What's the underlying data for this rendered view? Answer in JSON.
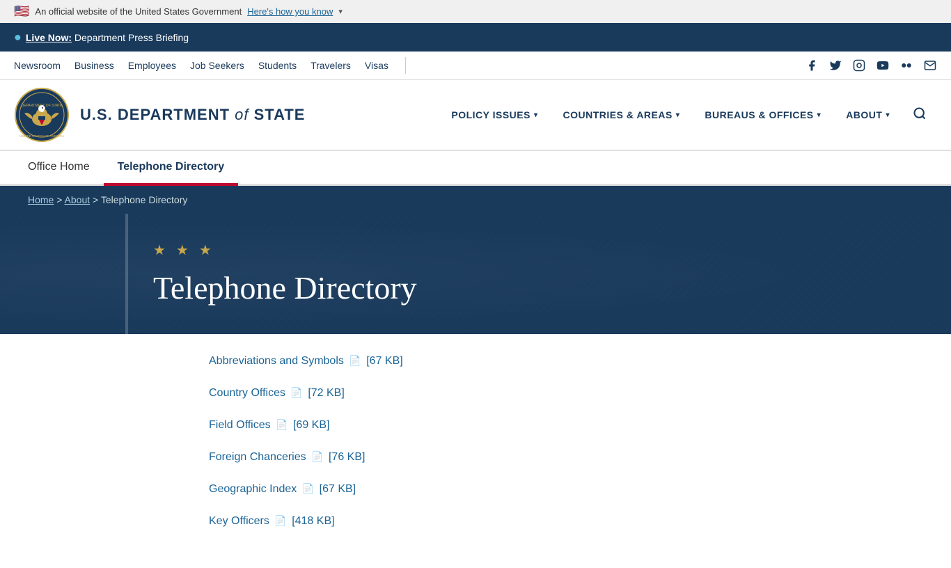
{
  "govBanner": {
    "flagEmoji": "🇺🇸",
    "text": "An official website of the United States Government",
    "linkText": "Here's how you know",
    "chevron": "▾"
  },
  "liveBar": {
    "dot": "●",
    "liveNow": "Live Now:",
    "linkText": "Department Press Briefing"
  },
  "topNav": {
    "links": [
      {
        "label": "Newsroom"
      },
      {
        "label": "Business"
      },
      {
        "label": "Employees"
      },
      {
        "label": "Job Seekers"
      },
      {
        "label": "Students"
      },
      {
        "label": "Travelers"
      },
      {
        "label": "Visas"
      }
    ],
    "socialLinks": [
      {
        "name": "facebook",
        "icon": "f"
      },
      {
        "name": "twitter",
        "icon": "𝕏"
      },
      {
        "name": "instagram",
        "icon": "📷"
      },
      {
        "name": "youtube",
        "icon": "▶"
      },
      {
        "name": "flickr",
        "icon": "✦"
      },
      {
        "name": "email",
        "icon": "✉"
      }
    ]
  },
  "header": {
    "deptLine1": "U.S. DEPARTMENT",
    "deptOf": "of",
    "deptLine2": "STATE",
    "mainNav": [
      {
        "label": "POLICY ISSUES",
        "hasCaret": true
      },
      {
        "label": "COUNTRIES & AREAS",
        "hasCaret": true
      },
      {
        "label": "BUREAUS & OFFICES",
        "hasCaret": true
      },
      {
        "label": "ABOUT",
        "hasCaret": true
      }
    ]
  },
  "officeTabs": [
    {
      "label": "Office Home",
      "active": false
    },
    {
      "label": "Telephone Directory",
      "active": true
    }
  ],
  "breadcrumb": {
    "items": [
      {
        "label": "Home",
        "link": true
      },
      {
        "label": "About",
        "link": true
      },
      {
        "label": "Telephone Directory",
        "link": false
      }
    ],
    "separator": ">"
  },
  "hero": {
    "stars": "★ ★ ★",
    "title": "Telephone Directory"
  },
  "contentLinks": [
    {
      "label": "Abbreviations and Symbols",
      "size": "[67 KB]"
    },
    {
      "label": "Country Offices",
      "size": "[72 KB]"
    },
    {
      "label": "Field Offices",
      "size": "[69 KB]"
    },
    {
      "label": "Foreign Chanceries",
      "size": "[76 KB]"
    },
    {
      "label": "Geographic Index",
      "size": "[67 KB]"
    },
    {
      "label": "Key Officers",
      "size": "[418 KB]"
    }
  ]
}
